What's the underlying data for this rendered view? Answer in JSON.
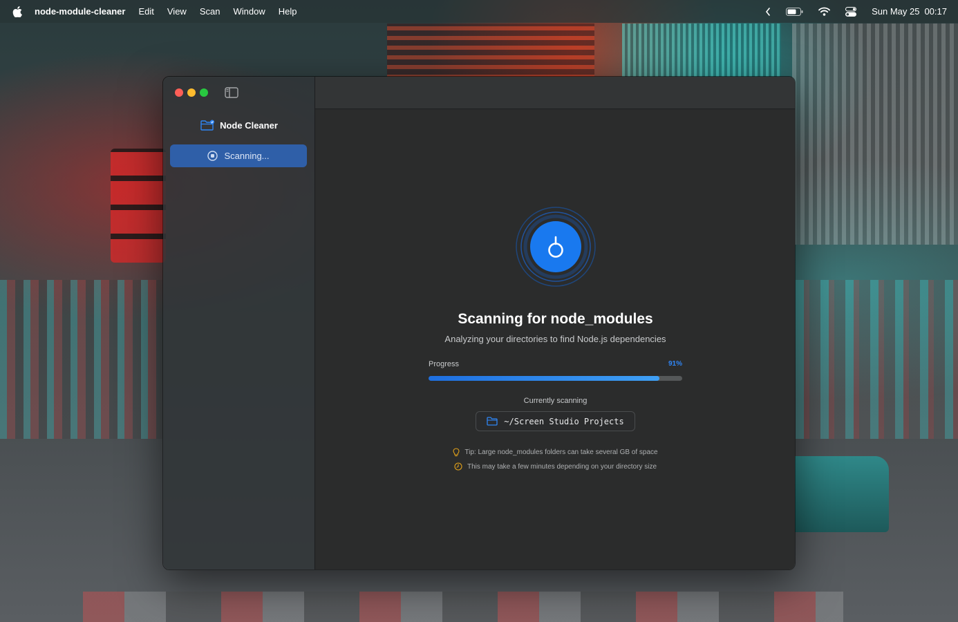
{
  "menubar": {
    "app_name": "node-module-cleaner",
    "items": [
      "Edit",
      "View",
      "Scan",
      "Window",
      "Help"
    ],
    "status_icons": [
      "chevron-left-icon",
      "battery-icon",
      "wifi-icon",
      "control-center-icon"
    ],
    "date": "Sun May 25",
    "time": "00:17"
  },
  "sidebar": {
    "brand_label": "Node Cleaner",
    "brand_icon": "folder-badge-icon",
    "scan_button_label": "Scanning...",
    "scan_button_icon": "stop-circle-icon"
  },
  "main": {
    "title": "Scanning for node_modules",
    "subtitle": "Analyzing your directories to find Node.js dependencies",
    "progress_label": "Progress",
    "progress_percent_text": "91%",
    "progress_value": 0.91,
    "current_label": "Currently scanning",
    "current_path": "~/Screen Studio Projects",
    "tips": [
      {
        "icon": "lightbulb-icon",
        "text": "Tip: Large node_modules folders can take several GB of space"
      },
      {
        "icon": "clock-icon",
        "text": "This may take a few minutes depending on your directory size"
      }
    ]
  },
  "colors": {
    "accent": "#2f86f6",
    "sidebar_selected": "#2f5fa8",
    "tip_icon": "#e3a21a",
    "close": "#fe5f57",
    "minimize": "#febc2e",
    "zoom": "#28c840"
  }
}
